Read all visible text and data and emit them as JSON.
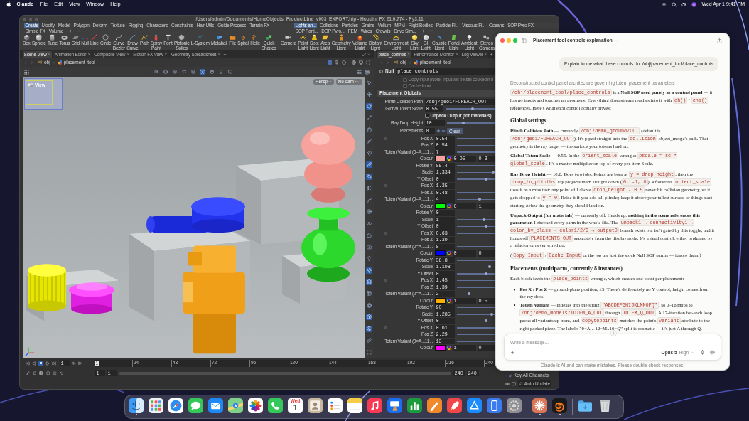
{
  "menubar": {
    "app": "Claude",
    "menus": [
      "File",
      "Edit",
      "View",
      "Window",
      "Help"
    ],
    "clock": "Wed Apr 1 9:41 PM"
  },
  "houdini": {
    "title": "/Users/admin/Documents/HomeObjects_ProductLine_v003_EXPORT.hip - Houdini FX 21.0.774 - Py3.11",
    "shelf_tabs_left": [
      {
        "label": "Create",
        "selected": true
      },
      {
        "label": "Modify",
        "selected": false
      },
      {
        "label": "Model",
        "selected": false
      },
      {
        "label": "Polygon",
        "selected": false
      },
      {
        "label": "Deform",
        "selected": false
      },
      {
        "label": "Texture",
        "selected": false
      },
      {
        "label": "Rigging",
        "selected": false
      },
      {
        "label": "Characters",
        "selected": false
      },
      {
        "label": "Constraints",
        "selected": false
      },
      {
        "label": "Hair Utils",
        "selected": false
      },
      {
        "label": "Guide Process",
        "selected": false
      },
      {
        "label": "Terrain FX",
        "selected": false
      },
      {
        "label": "Simple FX",
        "selected": false
      },
      {
        "label": "Volume",
        "selected": false
      }
    ],
    "shelf_tabs_right": [
      {
        "label": "Lights an...",
        "selected": true
      },
      {
        "label": "Collisions",
        "selected": false
      },
      {
        "label": "Particles",
        "selected": false
      },
      {
        "label": "Grains",
        "selected": false
      },
      {
        "label": "Vellum",
        "selected": false
      },
      {
        "label": "MPM",
        "selected": false
      },
      {
        "label": "Rigid Bodies",
        "selected": false
      },
      {
        "label": "Particle Fl...",
        "selected": false
      },
      {
        "label": "Viscous Fl...",
        "selected": false
      },
      {
        "label": "Oceans",
        "selected": false
      },
      {
        "label": "SOP Pyro FX",
        "selected": false
      },
      {
        "label": "SOP Parti...",
        "selected": false
      },
      {
        "label": "DOP Pyro...",
        "selected": false
      },
      {
        "label": "FEM",
        "selected": false
      },
      {
        "label": "Wires",
        "selected": false
      },
      {
        "label": "Crowds",
        "selected": false
      },
      {
        "label": "Drive Sim...",
        "selected": false
      }
    ],
    "shelf_tools_left": [
      "Box",
      "Sphere",
      "Tube",
      "Torus",
      "Grid",
      "Null",
      "Line",
      "Circle",
      "Curve Bezier",
      "Draw Curve",
      "Path",
      "Spray Paint",
      "Font",
      "Platonic Solids",
      "L-System",
      "Metaball",
      "File",
      "Spiral",
      "Helix",
      "Quick Shapes"
    ],
    "shelf_tools_right": [
      "Camera",
      "Point Light",
      "Spot Light",
      "Area Light",
      "Geometry Light",
      "Volume Light",
      "Distant Light",
      "Environment Light",
      "Sky Light",
      "GI Light",
      "Caustic Light",
      "Portal Light",
      "Ambient Light",
      "Stereo Camera"
    ],
    "scene_tabs": [
      {
        "label": "Scene View",
        "selected": true
      },
      {
        "label": "Animation Editor",
        "selected": false
      },
      {
        "label": "Composite View",
        "selected": false
      },
      {
        "label": "Motion FX View",
        "selected": false
      },
      {
        "label": "Geometry Spreadsheet",
        "selected": false
      }
    ],
    "scene_path": [
      "obj",
      "placement_tool"
    ],
    "view_tools": [
      {
        "on": false
      },
      {
        "on": false
      },
      {
        "on": false
      },
      {
        "on": false
      },
      {
        "on": false
      },
      {
        "on": true
      },
      {
        "on": false
      },
      {
        "on": false
      },
      {
        "on": false
      }
    ],
    "side_tools": [
      {
        "on": false
      },
      {
        "on": false
      },
      {
        "on": true
      },
      {
        "on": false
      },
      {
        "on": false
      },
      {
        "on": false
      },
      {
        "on": false
      },
      {
        "on": true
      },
      {
        "on": true
      },
      {
        "on": false
      },
      {
        "on": false
      },
      {
        "on": false
      },
      {
        "on": false
      },
      {
        "on": false
      },
      {
        "on": false
      },
      {
        "on": false
      },
      {
        "on": true
      },
      {
        "on": true
      },
      {
        "on": false
      },
      {
        "on": false
      },
      {
        "on": true
      },
      {
        "on": true
      },
      {
        "on": false
      },
      {
        "on": false
      }
    ],
    "viewport": {
      "label": "View",
      "menus": [
        "Persp",
        "No cam"
      ]
    },
    "param_tabs": [
      {
        "label": "place_controls",
        "selected": true
      },
      {
        "label": "Performance Monitor",
        "selected": false
      },
      {
        "label": "Log Viewer",
        "selected": false
      }
    ],
    "param_path": [
      "obj",
      "placement_tool"
    ],
    "node": {
      "type": "Null",
      "name": "place_controls"
    },
    "stock_toggles": [
      {
        "label": "Copy Input (Note: Input will be still cooked if d",
        "checked": false,
        "disabled": true
      },
      {
        "label": "Cache Input",
        "checked": false,
        "disabled": true
      }
    ],
    "section": "Placement Globals",
    "globals": [
      {
        "kind": "text",
        "label": "Plinth Collision Path",
        "value": "/obj/geo1/FOREACH_OUT"
      },
      {
        "kind": "slider",
        "label": "Global Totem Scale",
        "value": "0.55",
        "level": 0.54
      },
      {
        "kind": "toggle",
        "label": "Unpack Output (for materials)",
        "checked": false
      },
      {
        "kind": "slider",
        "label": "Ray Drop Height",
        "value": "10",
        "level": 0.33
      }
    ],
    "multiparm": {
      "label": "Placements",
      "value": "8",
      "clear": "Clear"
    },
    "instances": [
      {
        "rows": [
          {
            "kind": "number",
            "label": "Pos X",
            "value": "0.54"
          },
          {
            "kind": "number",
            "label": "Pos Z",
            "value": "0.54"
          },
          {
            "kind": "number",
            "label": "Totem Variant (0=A...11...",
            "value": "7"
          },
          {
            "kind": "colour",
            "label": "Colour",
            "color": "#f8a19c",
            "values": [
              "0.95",
              "0.3"
            ]
          },
          {
            "kind": "number",
            "label": "Rotate Y",
            "value": "85.4"
          },
          {
            "kind": "number",
            "label": "Scale",
            "value": "1.334",
            "level": 0.96
          },
          {
            "kind": "number",
            "label": "Y Offset",
            "value": "0",
            "level": 0.76
          }
        ]
      },
      {
        "rows": [
          {
            "kind": "number",
            "label": "Pos X",
            "value": "1.35"
          },
          {
            "kind": "number",
            "label": "Pos Z",
            "value": "0.48"
          },
          {
            "kind": "number",
            "label": "Totem Variant (0=A...11...",
            "value": "4",
            "level": 0.58
          },
          {
            "kind": "colour",
            "label": "Colour",
            "color": "#00ff00",
            "values": [
              "0",
              "1"
            ]
          },
          {
            "kind": "number",
            "label": "Rotate Y",
            "value": "0"
          },
          {
            "kind": "number",
            "label": "Scale",
            "value": "1",
            "level": 0.71
          },
          {
            "kind": "number",
            "label": "Y Offset",
            "value": "0",
            "level": 0.76
          }
        ]
      },
      {
        "rows": [
          {
            "kind": "number",
            "label": "Pos X",
            "value": "0.63"
          },
          {
            "kind": "number",
            "label": "Pos Z",
            "value": "1.39"
          },
          {
            "kind": "number",
            "label": "Totem Variant (0=A...11...",
            "value": "8"
          },
          {
            "kind": "colour",
            "label": "Colour",
            "color": "#0000ff",
            "values": [
              "0",
              "0"
            ]
          },
          {
            "kind": "number",
            "label": "Rotate Y",
            "value": "38.8"
          },
          {
            "kind": "number",
            "label": "Scale",
            "value": "1.198",
            "level": 0.87
          },
          {
            "kind": "number",
            "label": "Y Offset",
            "value": "0",
            "level": 0.76
          }
        ]
      },
      {
        "rows": [
          {
            "kind": "number",
            "label": "Pos X",
            "value": "1.45"
          },
          {
            "kind": "number",
            "label": "Pos Z",
            "value": "1.39"
          },
          {
            "kind": "number",
            "label": "Totem Variant (0=A...11...",
            "value": "2",
            "level": 0.29
          },
          {
            "kind": "colour",
            "label": "Colour",
            "color": "#ffb000",
            "values": [
              "1",
              "0.5"
            ]
          },
          {
            "kind": "number",
            "label": "Rotate Y",
            "value": "90"
          },
          {
            "kind": "number",
            "label": "Scale",
            "value": "1.285",
            "level": 0.93
          },
          {
            "kind": "number",
            "label": "Y Offset",
            "value": "0",
            "level": 0.76
          }
        ]
      },
      {
        "rows": [
          {
            "kind": "number",
            "label": "Pos X",
            "value": "0.61"
          },
          {
            "kind": "number",
            "label": "Pos Z",
            "value": "2.29"
          },
          {
            "kind": "number",
            "label": "Totem Variant (0=A...11...",
            "value": "13"
          },
          {
            "kind": "colour",
            "label": "Colour",
            "color": "#ff00ff",
            "values": [
              "1",
              "0"
            ]
          }
        ]
      }
    ],
    "timeline": {
      "frame": "1",
      "marker": "1",
      "ticks": [
        "24",
        "48",
        "72",
        "96",
        "120",
        "144",
        "168",
        "192",
        "216",
        "240"
      ],
      "range_start": [
        "1",
        "1"
      ],
      "range_end": [
        "240",
        "240"
      ],
      "key_mode": "Key All Channels",
      "update_mode": "Auto Update"
    }
  },
  "claude": {
    "title": "Placement tool controls explanation",
    "user_message": "Explain to me what these controls do: /obj/placement_tool/place_controls",
    "thinking": "Deconstructed control panel architecture governing totem placement parameters",
    "blocks": [
      {
        "kind": "p",
        "parts": [
          {
            "code": "/obj/placement_tool/place_controls"
          },
          {
            "text": " is a **Null SOP used purely as a control panel** — it has no inputs and touches no geometry. Everything downstream reaches into it with "
          },
          {
            "code": "ch()"
          },
          {
            "text": " / "
          },
          {
            "code": "chs()"
          },
          {
            "text": " references. Here's what each control actually drives:"
          }
        ]
      },
      {
        "kind": "h",
        "text": "Global settings"
      },
      {
        "kind": "p",
        "parts": [
          {
            "text": "**Plinth Collision Path** — currently "
          },
          {
            "code": "/obj/demo_ground/OUT"
          },
          {
            "text": " (default is "
          },
          {
            "code": "/obj/geo1/FOREACH_OUT"
          },
          {
            "text": "). It's piped straight into the "
          },
          {
            "code": "collision"
          },
          {
            "text": " object_merge's path. That geometry is the ray target — the surface your totems land on."
          }
        ]
      },
      {
        "kind": "p",
        "parts": [
          {
            "text": "**Global Totem Scale** — 0.55. In the "
          },
          {
            "code": "orient_scale"
          },
          {
            "text": " wrangle: "
          },
          {
            "code": "pscale = sc * global_scale"
          },
          {
            "text": ". It's a master multiplier on top of every per-item Scale."
          }
        ]
      },
      {
        "kind": "p",
        "parts": [
          {
            "text": "**Ray Drop Height** — 10.0. Does two jobs. Points are born at "
          },
          {
            "code": "y = drop_height"
          },
          {
            "text": ", then the "
          },
          {
            "code": "drop_to_plinths"
          },
          {
            "text": " ray projects them straight down ("
          },
          {
            "code": "0, -1, 0"
          },
          {
            "text": "). Afterward, "
          },
          {
            "code": "orient_scale"
          },
          {
            "text": " uses it as a miss test: any point still above "
          },
          {
            "code": "drop_height - 0.5"
          },
          {
            "text": " never hit collision geometry, so it gets dropped to "
          },
          {
            "code": "y = 0"
          },
          {
            "text": ". Raise it if you add tall plinths; keep it above your tallest surface or things start starting *below* the geometry they should land on."
          }
        ]
      },
      {
        "kind": "p",
        "parts": [
          {
            "text": "**Unpack Output (for materials)** — currently off. Heads up: **nothing in the scene references this parameter.** I checked every parm in the whole file. The "
          },
          {
            "code": "unpack1 → connectivity1 → color_by_class → color1/2/3 → output0"
          },
          {
            "text": " branch exists but isn't gated by this toggle, and it hangs off "
          },
          {
            "code": "PLACEMENTS_OUT"
          },
          {
            "text": " separately from the display node. It's a dead control, either orphaned by a refactor or never wired up."
          }
        ]
      },
      {
        "kind": "p",
        "parts": [
          {
            "text": "("
          },
          {
            "code": "Copy Input"
          },
          {
            "text": " / "
          },
          {
            "code": "Cache Input"
          },
          {
            "text": " at the top are just the stock Null SOP parms — ignore them.)"
          }
        ]
      },
      {
        "kind": "h",
        "text": "Placements (multiparm, currently 8 instances)"
      },
      {
        "kind": "p",
        "parts": [
          {
            "text": "Each block feeds the "
          },
          {
            "code": "place_points"
          },
          {
            "text": " wrangle, which creates one point per placement:"
          }
        ]
      },
      {
        "kind": "list",
        "items": [
          {
            "parts": [
              {
                "text": "**Pos X / Pos Z** — ground-plane position, ±5. There's deliberately no Y control; height comes from the ray drop."
              }
            ]
          },
          {
            "parts": [
              {
                "text": "**Totem Variant** — indexes into the string "
              },
              {
                "code": "\"ABCDEFGHIJKLMNOPQ\""
              },
              {
                "text": ", so 0–16 maps to "
              },
              {
                "code": "/obj/demo_models/TOTEM_A_OUT"
              },
              {
                "text": " through "
              },
              {
                "code": "TOTEM_Q_OUT"
              },
              {
                "text": ". A 17-iteration for-each loop packs all variants up front, and "
              },
              {
                "code": "copytopoints"
              },
              {
                "text": " matches the point's "
              },
              {
                "code": "variant"
              },
              {
                "text": " attribute to the right packed piece. The label's “0=A.., 12=M..16=Q” split is cosmetic — it's just A through Q."
              }
            ]
          }
        ]
      }
    ],
    "composer": {
      "placeholder": "Write a message...",
      "model": "Opus 5",
      "effort": "High"
    },
    "disclaimer": "Claude is AI and can make mistakes. Please double-check responses."
  },
  "dock": {
    "apps": [
      {
        "running": true
      },
      {
        "running": false
      },
      {
        "running": false
      },
      {
        "running": false
      },
      {
        "running": false
      },
      {
        "running": false
      },
      {
        "running": false
      },
      {
        "running": false
      },
      {
        "running": false,
        "day": "Wed",
        "date": "1"
      },
      {
        "running": false
      },
      {
        "running": false
      },
      {
        "running": false
      },
      {
        "running": false
      },
      {
        "running": false
      },
      {
        "running": false
      },
      {
        "running": false
      },
      {
        "running": false
      },
      {
        "running": false
      },
      {
        "running": false
      },
      {
        "running": false
      }
    ],
    "recent": [
      {
        "running": true
      },
      {
        "running": true
      }
    ]
  }
}
